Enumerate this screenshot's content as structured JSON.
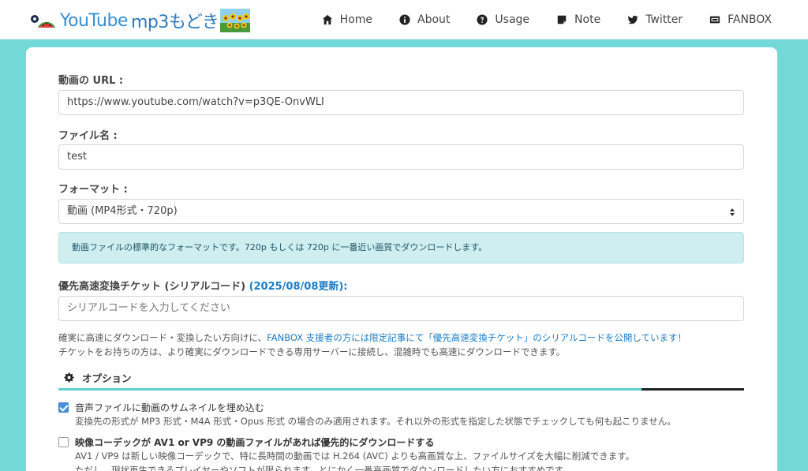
{
  "brand": {
    "part1": "YouTube",
    "part2": "mp3もどき"
  },
  "nav": [
    {
      "label": "Home",
      "icon": "home-icon"
    },
    {
      "label": "About",
      "icon": "info-icon"
    },
    {
      "label": "Usage",
      "icon": "question-icon"
    },
    {
      "label": "Note",
      "icon": "note-icon"
    },
    {
      "label": "Twitter",
      "icon": "twitter-icon"
    },
    {
      "label": "FANBOX",
      "icon": "fanbox-icon"
    }
  ],
  "form": {
    "url_label": "動画の URL :",
    "url_value": "https://www.youtube.com/watch?v=p3QE-OnvWLI",
    "filename_label": "ファイル名 :",
    "filename_value": "test",
    "format_label": "フォーマット :",
    "format_value": "動画 (MP4形式・720p)",
    "format_info": "動画ファイルの標準的なフォーマットです。720p もしくは 720p に一番近い画質でダウンロードします。",
    "ticket_label": "優先高速変換チケット (シリアルコード)",
    "ticket_date": "(2025/08/08更新):",
    "ticket_placeholder": "シリアルコードを入力してください"
  },
  "note": {
    "line1_a": "確実に高速にダウンロード・変換したい方向けに、",
    "line1_link": "FANBOX 支援者の方には限定記事にて「優先高速変換チケット」のシリアルコードを公開しています！",
    "line2": "チケットをお持ちの方は、より確実にダウンロードできる専用サーバーに接続し、混雑時でも高速にダウンロードできます。"
  },
  "options": {
    "title": "オプション",
    "progress_fraction": 0.85,
    "items": [
      {
        "checked": true,
        "label": "音声ファイルに動画のサムネイルを埋め込む",
        "desc": [
          "変換先の形式が MP3 形式・M4A 形式・Opus 形式 の場合のみ適用されます。それ以外の形式を指定した状態でチェックしても何も起こりません。"
        ]
      },
      {
        "checked": false,
        "label": "映像コーデックが AV1 or VP9 の動画ファイルがあれば優先的にダウンロードする",
        "desc": [
          "AV1 / VP9 は新しい映像コーデックで、特に長時間の動画では H.264 (AVC) よりも高画質な上、ファイルサイズを大幅に削減できます。",
          "ただし、現状再生できるプレイヤーやソフトが限られます。とにかく一番高画質でダウンロードしたい方におすすめです。"
        ]
      }
    ]
  },
  "colors": {
    "background": "#72d8d8",
    "accent": "#5ccfd0",
    "link": "#1a7bc7",
    "checkbox": "#4a90d9"
  }
}
